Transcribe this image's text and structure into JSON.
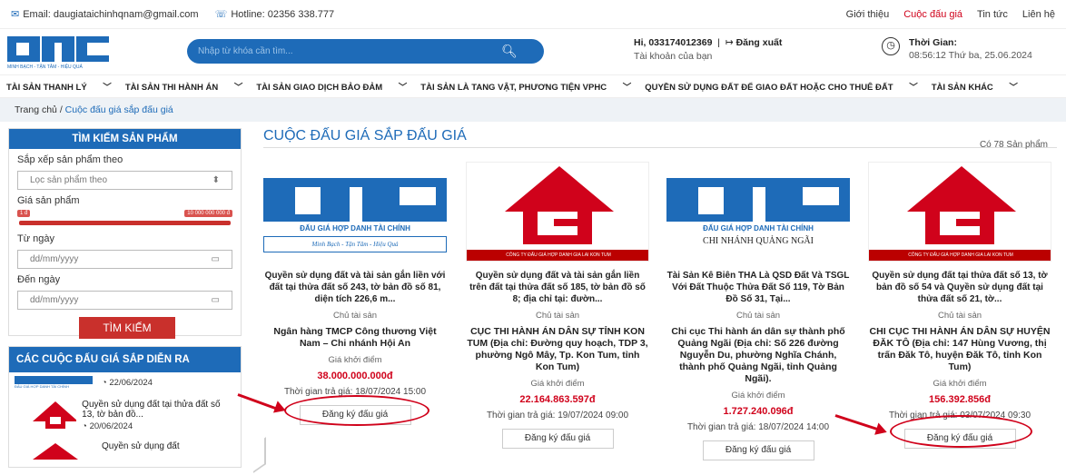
{
  "topbar": {
    "email": "Email: daugiataichinhqnam@gmail.com",
    "hotline": "Hotline: 02356 338.777",
    "links": [
      "Giới thiệu",
      "Cuộc đấu giá",
      "Tin tức",
      "Liên hệ"
    ]
  },
  "header": {
    "logo_caption": "MINH BẠCH - TẬN TÂM - HIỆU QUẢ",
    "search_placeholder": "Nhập từ khóa cần tìm...",
    "user": "Hi, 033174012369",
    "logout": "Đăng xuất",
    "account": "Tài khoản của bạn",
    "time_label": "Thời Gian:",
    "time_value": "08:56:12 Thứ ba, 25.06.2024"
  },
  "nav": [
    "TÀI SẢN THANH LÝ",
    "TÀI SẢN THI HÀNH ÁN",
    "TÀI SẢN GIAO DỊCH BẢO ĐẢM",
    "TÀI SẢN LÀ TANG VẬT, PHƯƠNG TIỆN VPHC",
    "QUYỀN SỬ DỤNG ĐẤT ĐỂ GIAO ĐẤT HOẶC CHO THUÊ ĐẤT",
    "TÀI SẢN KHÁC"
  ],
  "breadcrumb": {
    "home": "Trang chủ",
    "sep": "/",
    "current": "Cuộc đấu giá sắp đấu giá"
  },
  "sidebar": {
    "title": "TÌM KIẾM SẢN PHẨM",
    "sort_label": "Sắp xếp sản phẩm theo",
    "sort_value": "Lọc sản phẩm theo",
    "price_label": "Giá sản phẩm",
    "price_min": "1 đ",
    "price_max": "10 000 000 000 đ",
    "from_label": "Từ ngày",
    "to_label": "Đến ngày",
    "date_placeholder": "dd/mm/yyyy",
    "search_button": "TÌM KIẾM",
    "upcoming_title": "CÁC CUỘC ĐẤU GIÁ SẮP DIỄN RA",
    "upcoming": [
      {
        "date": "22/06/2024",
        "title": ""
      },
      {
        "date": "20/06/2024",
        "title": "Quyền sử dụng đất tại thửa đất số 13, tờ bản đồ..."
      },
      {
        "date": "",
        "title": "Quyền sử dụng đất"
      }
    ]
  },
  "main": {
    "title": "CUỘC ĐẤU GIÁ SẮP ĐẤU GIÁ",
    "count": "Có 78 Sản phẩm",
    "owner_label": "Chủ tài sản",
    "price_label": "Giá khởi điểm",
    "register": "Đăng ký đấu giá",
    "cards": [
      {
        "title": "Quyền sử dụng đất và tài sản gắn liền với đất tại thửa đất số 243, tờ bản đồ số 81, diện tích 226,6 m...",
        "owner": "Ngân hàng TMCP Công thương Việt Nam – Chi nhánh Hội An",
        "price": "38.000.000.000đ",
        "time": "Thời gian trả giá: 18/07/2024 15:00",
        "logo": "otc",
        "logo_text": "ĐẤU GIÁ HỢP DANH TÀI CHÍNH",
        "logo_sub": "Minh Bạch - Tận Tâm - Hiệu Quả"
      },
      {
        "title": "Quyền sử dụng đất và tài sản gắn liền trên đất tại thửa đất số 185, tờ bản đồ số 8; địa chỉ tại: đườn...",
        "owner": "CỤC THI HÀNH ÁN DÂN SỰ TỈNH KON TUM (Địa chỉ: Đường quy hoạch, TDP 3, phường Ngô Mây, Tp. Kon Tum, tỉnh Kon Tum)",
        "price": "22.164.863.597đ",
        "time": "Thời gian trả giá: 19/07/2024 09:00",
        "logo": "gl",
        "logo_text": "CÔNG TY ĐẤU GIÁ HỢP DANH GIA LAI KON TUM",
        "logo_sub": ""
      },
      {
        "title": "Tài Sản Kê Biên THA Là QSD Đất Và TSGL Với Đất Thuộc Thửa Đất Số 119, Tờ Bản Đồ Số 31, Tại...",
        "owner": "Chi cục Thi hành án dân sự thành phố Quảng Ngãi (Địa chỉ: Số 226 đường Nguyễn Du, phường Nghĩa Chánh, thành phố Quảng Ngãi, tỉnh Quảng Ngãi).",
        "price": "1.727.240.096đ",
        "time": "Thời gian trả giá: 18/07/2024 14:00",
        "logo": "otc",
        "logo_text": "ĐẤU GIÁ HỢP DANH TÀI CHÍNH",
        "logo_sub": "CHI NHÁNH QUẢNG NGÃI"
      },
      {
        "title": "Quyền sử dụng đất tại thửa đất số 13, tờ bản đồ số 54 và Quyền sử dụng đất tại thửa đất số 21, tờ...",
        "owner": "CHI CỤC THI HÀNH ÁN DÂN SỰ HUYỆN ĐĂK TÔ (Địa chỉ: 147 Hùng Vương, thị trấn Đăk Tô, huyện Đăk Tô, tỉnh Kon Tum)",
        "price": "156.392.856đ",
        "time": "Thời gian trả giá: 03/07/2024 09:30",
        "logo": "gl",
        "logo_text": "CÔNG TY ĐẤU GIÁ HỢP DANH GIA LAI KON TUM",
        "logo_sub": ""
      }
    ]
  },
  "colors": {
    "primary": "#1e6bb8",
    "accent": "#d0021b"
  }
}
